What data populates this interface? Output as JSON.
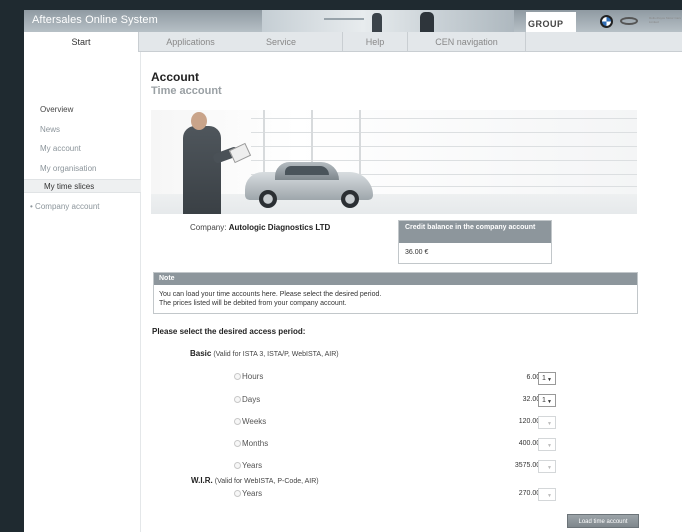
{
  "header": {
    "app_title": "Aftersales Online System",
    "group_logo_text": "GROUP",
    "partner_text": "Rolls-Royce Motor Cars Limited"
  },
  "nav": {
    "start": "Start",
    "tabs": [
      {
        "label": "Applications"
      },
      {
        "label": "Service"
      },
      {
        "label": "Help"
      },
      {
        "label": "CEN navigation"
      }
    ]
  },
  "sidebar": {
    "items": [
      {
        "label": "Overview"
      },
      {
        "label": "News"
      },
      {
        "label": "My account"
      },
      {
        "label": "My organisation"
      },
      {
        "label": "My time slices"
      },
      {
        "label": "Company account"
      }
    ]
  },
  "page": {
    "title": "Account",
    "subtitle": "Time account"
  },
  "company": {
    "label": "Company:",
    "name": "Autologic Diagnostics LTD"
  },
  "credit": {
    "heading": "Credit balance in the company account",
    "value": "36.00 €"
  },
  "note": {
    "heading": "Note",
    "line1": "You can load your time accounts here. Please select the desired period.",
    "line2": "The prices listed will be debited from your company account."
  },
  "selection": {
    "heading": "Please select the desired access period:",
    "basic": {
      "name": "Basic",
      "desc": "(Valid for ISTA 3, ISTA/P, WebISTA, AIR)",
      "options": [
        {
          "label": "Hours",
          "price": "6.00 €",
          "qty": "1",
          "enabled": true
        },
        {
          "label": "Days",
          "price": "32.00 €",
          "qty": "1",
          "enabled": true
        },
        {
          "label": "Weeks",
          "price": "120.00 €",
          "qty": "",
          "enabled": false
        },
        {
          "label": "Months",
          "price": "400.00 €",
          "qty": "",
          "enabled": false
        },
        {
          "label": "Years",
          "price": "3575.00 €",
          "qty": "",
          "enabled": false
        }
      ]
    },
    "wir": {
      "name": "W.I.R.",
      "desc": "(Valid for WebISTA, P-Code, AIR)",
      "options": [
        {
          "label": "Years",
          "price": "270.00 €",
          "qty": "",
          "enabled": false
        }
      ]
    }
  },
  "actions": {
    "load_label": "Load time account"
  }
}
